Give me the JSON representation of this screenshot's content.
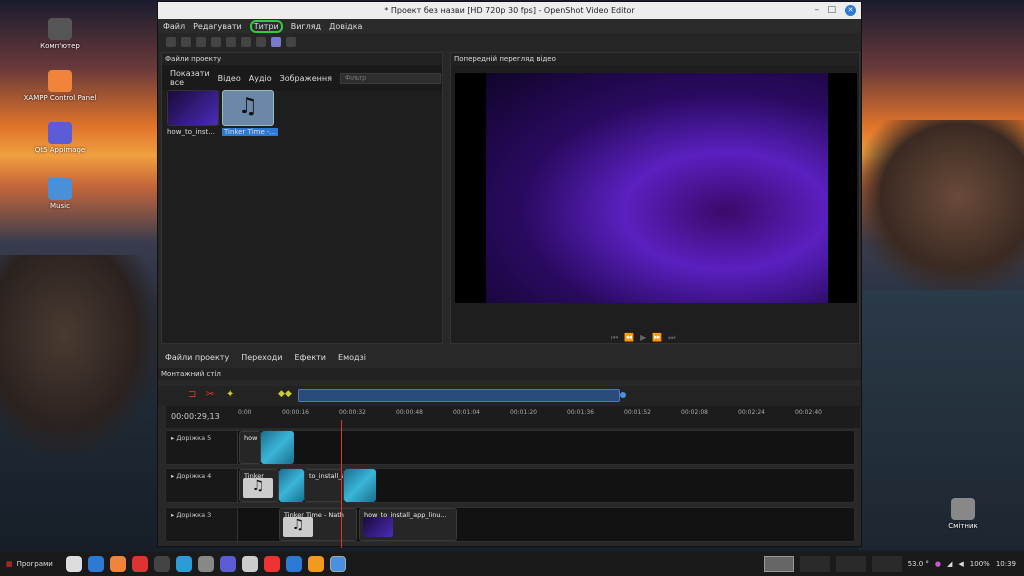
{
  "desktop": {
    "icons": [
      {
        "label": "Комп'ютер",
        "color": "#555"
      },
      {
        "label": "XAMPP Control Panel",
        "color": "#f0843a"
      },
      {
        "label": "Qt5 Appimage",
        "color": "#5b5bd6"
      },
      {
        "label": "Music",
        "color": "#4a90d9"
      },
      {
        "label": "Смітник",
        "color": "#888"
      }
    ]
  },
  "window": {
    "title": "* Проект без назви [HD 720p 30 fps] - OpenShot Video Editor"
  },
  "menu": [
    "Файл",
    "Редагувати",
    "Титри",
    "Вигляд",
    "Довідка"
  ],
  "project_files": {
    "title": "Файли проекту",
    "tabs": [
      "Показати все",
      "Відео",
      "Аудіо",
      "Зображення"
    ],
    "filter_placeholder": "Фільтр",
    "items": [
      {
        "name": "how_to_inst..."
      },
      {
        "name": "Tinker Time -..."
      }
    ]
  },
  "preview": {
    "title": "Попередній перегляд відео"
  },
  "bottom_tabs": [
    "Файли проекту",
    "Переходи",
    "Ефекти",
    "Емодзі"
  ],
  "timeline": {
    "title": "Монтажний стіл",
    "timecode": "00:00:29,13",
    "ticks": [
      "0:00",
      "00:00:16",
      "00:00:32",
      "00:00:48",
      "00:01:04",
      "00:01:20",
      "00:01:36",
      "00:01:52",
      "00:02:08",
      "00:02:24",
      "00:02:40"
    ],
    "tracks": [
      {
        "name": "Доріжка 5",
        "clips": [
          "how"
        ]
      },
      {
        "name": "Доріжка 4",
        "clips": [
          "Tinker Tim",
          "to_install_ap"
        ]
      },
      {
        "name": "Доріжка 3",
        "clips": [
          "Tinker Time - Nath",
          "how_to_install_app_linu..."
        ]
      }
    ]
  },
  "taskbar": {
    "start": "Програми",
    "temp": "53.0 °",
    "battery": "100%",
    "time": "10:39"
  }
}
